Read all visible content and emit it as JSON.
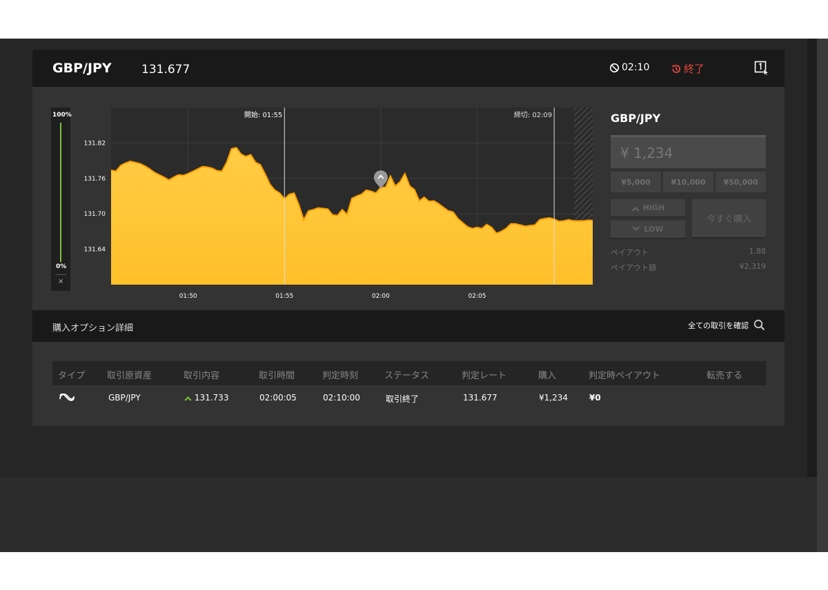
{
  "header": {
    "asset": "GBP/JPY",
    "price": "131.677",
    "timer": "02:10",
    "status": "終了"
  },
  "gauge": {
    "top_label": "100%",
    "bottom_label": "0%",
    "close_label": "×",
    "level": 1.0
  },
  "chart_data": {
    "type": "area",
    "y_ticks": [
      "131.82",
      "131.76",
      "131.70",
      "131.64"
    ],
    "ylim": [
      131.58,
      131.88
    ],
    "x_ticks": [
      "01:50",
      "01:55",
      "02:00",
      "02:05"
    ],
    "start_label": "開始: 01:55",
    "end_label": "締切: 02:09",
    "entry_marker": {
      "time": "02:00",
      "price": 131.742
    },
    "colors": {
      "fill_top": "#ffcc44",
      "fill_bottom": "#ffc02a",
      "stroke": "#ff9d00",
      "plot_bg": "#2b2b2b"
    },
    "series": [
      {
        "x_minutes": [
          0,
          0.25,
          0.5,
          0.75,
          1.0,
          1.25,
          1.5,
          1.75,
          2.0,
          2.25,
          2.5,
          2.75,
          3.0,
          3.25,
          3.5,
          3.75,
          4.0,
          4.25,
          4.5,
          4.75,
          5.0,
          5.25,
          5.5,
          5.75,
          6.0,
          6.25,
          6.5,
          6.75,
          7.0,
          7.25,
          7.5,
          7.75,
          8.0,
          8.25,
          8.5,
          8.75,
          9.0,
          9.25,
          9.5,
          9.75,
          10.0,
          10.25,
          10.5,
          10.75,
          11.0,
          11.25,
          11.5,
          11.75,
          12.0,
          12.25,
          12.5,
          12.75,
          13.0,
          13.25,
          13.5,
          13.75,
          14.0,
          14.25,
          14.5,
          14.75,
          15.0,
          15.25,
          15.5,
          15.75,
          16.0,
          16.25,
          16.5,
          16.75,
          17.0,
          17.25,
          17.5,
          17.75,
          18.0,
          18.25,
          18.5,
          18.75,
          19.0,
          19.25,
          19.5,
          19.75,
          20.0,
          20.25,
          20.5,
          20.75,
          21.0,
          21.25,
          21.5,
          21.75,
          22.0,
          22.25,
          22.5,
          22.75,
          23.0,
          23.25,
          23.5,
          23.75,
          24.0,
          24.25,
          24.5,
          24.75,
          25.0
        ],
        "values": [
          131.774,
          131.772,
          131.782,
          131.786,
          131.789,
          131.787,
          131.785,
          131.781,
          131.776,
          131.77,
          131.766,
          131.762,
          131.757,
          131.762,
          131.766,
          131.765,
          131.768,
          131.772,
          131.776,
          131.78,
          131.779,
          131.777,
          131.773,
          131.772,
          131.787,
          131.81,
          131.812,
          131.801,
          131.797,
          131.8,
          131.787,
          131.783,
          131.767,
          131.75,
          131.74,
          131.735,
          131.725,
          131.733,
          131.735,
          131.715,
          131.69,
          131.705,
          131.707,
          131.71,
          131.709,
          131.708,
          131.698,
          131.697,
          131.707,
          131.699,
          131.726,
          131.73,
          131.733,
          131.74,
          131.738,
          131.735,
          131.745,
          131.745,
          131.764,
          131.747,
          131.754,
          131.768,
          131.747,
          131.741,
          131.722,
          131.728,
          131.721,
          131.722,
          131.717,
          131.711,
          131.705,
          131.703,
          131.692,
          131.685,
          131.678,
          131.675,
          131.677,
          131.675,
          131.682,
          131.677,
          131.667,
          131.67,
          131.675,
          131.683,
          131.683,
          131.681,
          131.679,
          131.68,
          131.681,
          131.69,
          131.692,
          131.693,
          131.691,
          131.687,
          131.688,
          131.69,
          131.688,
          131.688,
          131.688,
          131.689,
          131.689
        ]
      }
    ]
  },
  "trade_panel": {
    "asset": "GBP/JPY",
    "amount_placeholder": "¥ 1,234",
    "presets": [
      "¥5,000",
      "¥10,000",
      "¥50,000"
    ],
    "high_label": "HIGH",
    "low_label": "LOW",
    "buy_label": "今すぐ購入",
    "payout_label": "ペイアウト",
    "payout_value": "1.88",
    "payout_amount_label": "ペイアウト額",
    "payout_amount_value": "¥2,319"
  },
  "details": {
    "title": "購入オプション詳細",
    "all_trades_label": "全ての取引を確認",
    "columns": [
      "タイプ",
      "取引原資産",
      "取引内容",
      "取引時間",
      "判定時刻",
      "ステータス",
      "判定レート",
      "購入",
      "判定時ペイアウト",
      "転売する"
    ],
    "rows": [
      {
        "type_icon": "spread-type-icon",
        "asset": "GBP/JPY",
        "content": "131.733",
        "trade_time": "02:00:05",
        "judge_time": "02:10:00",
        "status": "取引終了",
        "judge_rate": "131.677",
        "purchase": "¥1,234",
        "payout": "¥0"
      }
    ]
  }
}
